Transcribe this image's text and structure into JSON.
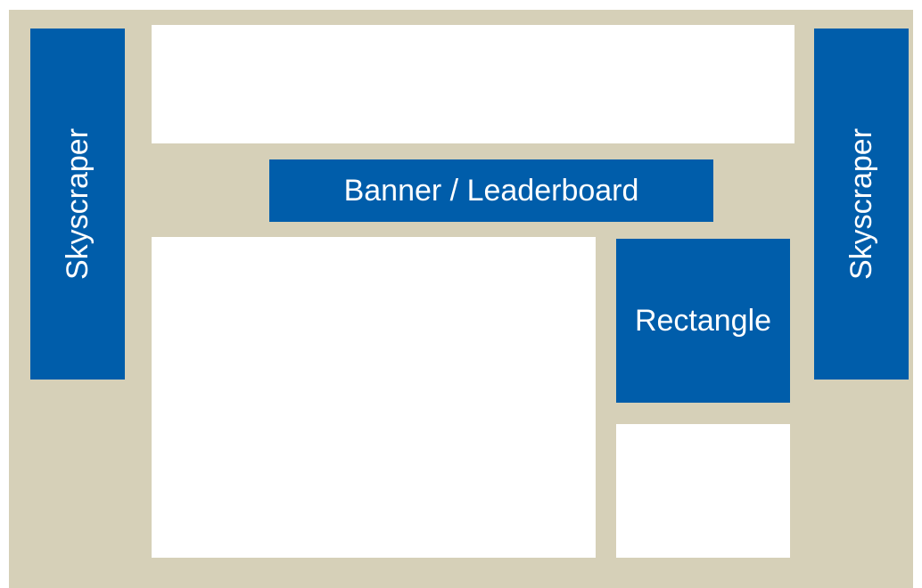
{
  "layout_diagram": {
    "colors": {
      "background": "#d6d0b8",
      "ad_block": "#005daa",
      "content_block": "#ffffff",
      "ad_text": "#ffffff"
    },
    "skyscraper_left": {
      "label": "Skyscraper"
    },
    "skyscraper_right": {
      "label": "Skyscraper"
    },
    "banner": {
      "label": "Banner / Leaderboard"
    },
    "rectangle": {
      "label": "Rectangle"
    }
  }
}
